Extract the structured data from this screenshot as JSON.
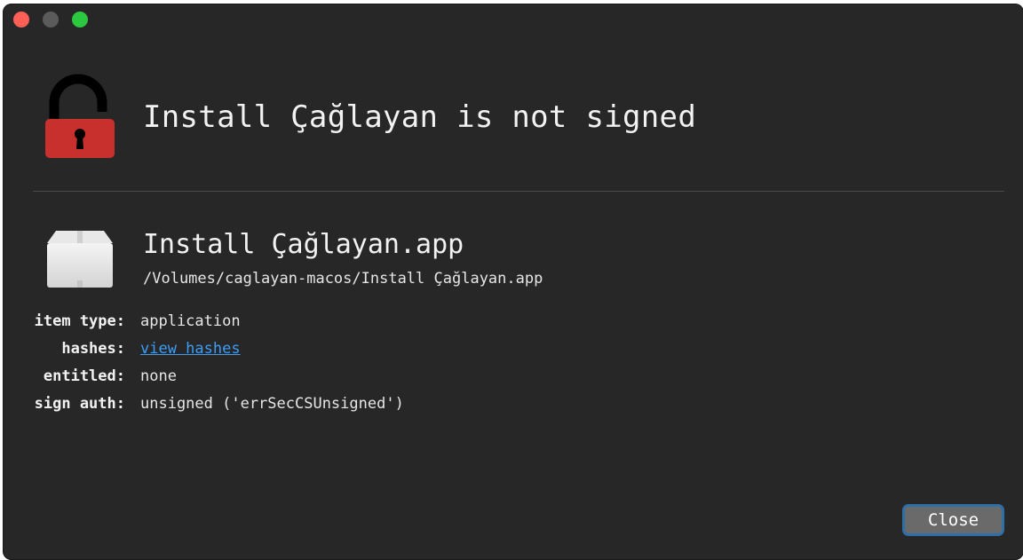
{
  "window": {
    "traffic_lights": [
      "close",
      "minimize",
      "zoom"
    ]
  },
  "header": {
    "icon": "unlocked-padlock-icon",
    "title": "Install Çağlayan is not signed"
  },
  "item": {
    "icon": "package-box-icon",
    "name": "Install Çağlayan.app",
    "path": "/Volumes/caglayan-macos/Install Çağlayan.app"
  },
  "info": {
    "item_type_label": "item type:",
    "item_type_value": "application",
    "hashes_label": "hashes:",
    "hashes_value": "view hashes",
    "entitled_label": "entitled:",
    "entitled_value": "none",
    "sign_auth_label": "sign auth:",
    "sign_auth_value": "unsigned ('errSecCSUnsigned')"
  },
  "buttons": {
    "close_label": "Close"
  },
  "colors": {
    "background": "#272727",
    "lock_red": "#c8302d",
    "link": "#3e9cf5",
    "button_focus": "#2f6fa8"
  }
}
